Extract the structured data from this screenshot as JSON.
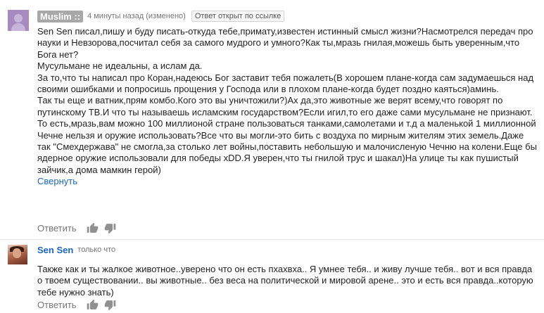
{
  "comments": [
    {
      "author": "Muslim ::",
      "time": "4 минуты назад (изменено)",
      "badge": "Ответ открыт по ссылке",
      "paragraphs": [
        "Sen Sen писал,пишу и буду писать-откуда тебе,примату,известен истинный смысл жизни?Насмотрелся передач про науки и Невзорова,посчитал себя за самого мудрого и умного?Как ты,мразь гнилая,можешь быть уверенным,что Бога нет?",
        "Мусульмане не идеальны, а ислам да.",
        "За то,что ты написал про Коран,надеюсь Бог заставит тебя пожалеть(В хорошем плане-когда сам задумаешься над своими ошибками и попросишь прощения у Господа или в плохом плане-когда будет поздно каяться)аминь.",
        "Так ты еще и ватник,прям комбо.Кого это вы уничтожили?)Ах да,это животные же верят всему,что говорят по путинскому ТВ.И что ты называешь исламским государством?Если игил,то его даже сами мусульмане не признают.",
        "То есть,мразь,вам можно 100 миллионой стране пользоваться танками,самолетами и т.д а маленькой 1 миллионной Чечне нельзя и оружие использовать?Все что вы могли-это бить с воздуха по мирным жителям этих земель.Даже так \"Смехдержава\" не смогла,за столько лет войны,поставить небольшую и малочисленую Чечню на колени.Еще бы ядерное оружие использовали для победы xDD.Я уверен,что ты гнилой трус и шакал)На улице ты как пушистый зайчик,а дома мамкин герой)"
      ],
      "collapse": "Свернуть",
      "reply": "Ответить"
    },
    {
      "author": "Sen Sen",
      "time": "только что",
      "paragraphs": [
        "Также как и ты  жалкое животное..уверено что он есть пхахвха.. Я умнее тебя..  и живу лучше тебя.. вот и вся правда  о твоем существовании.. вы животные.. без веса на политической и мировой арене.. это и есть вся правда..которую тебе нужно знать)"
      ],
      "reply": "Ответить"
    }
  ],
  "icons": {
    "like": "thumbs-up-icon",
    "dislike": "thumbs-down-icon"
  },
  "colors": {
    "link": "#1a66c8",
    "muted": "#767676",
    "text": "#222222"
  }
}
